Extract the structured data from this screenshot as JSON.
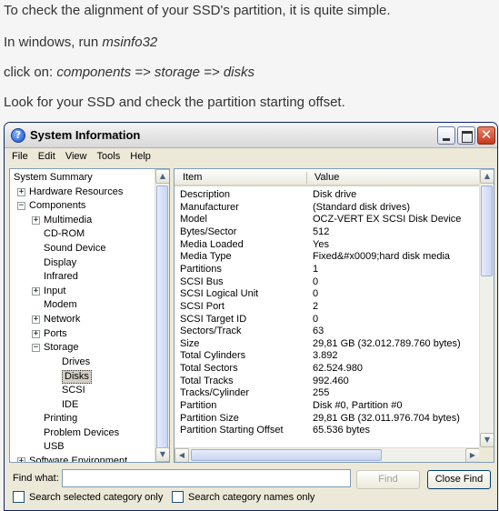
{
  "article": {
    "p1": "To check the alignment of your SSD's partition, it is quite simple.",
    "p2_prefix": "In windows, run ",
    "p2_cmd": "msinfo32",
    "p3_prefix": "click on: ",
    "p3_path": "components => storage => disks",
    "p4": "Look for your SSD and check the partition starting offset."
  },
  "window": {
    "title": "System Information",
    "app_icon": "help-icon",
    "close_glyph": "✕"
  },
  "menu": [
    "File",
    "Edit",
    "View",
    "Tools",
    "Help"
  ],
  "tree": [
    {
      "label": "System Summary",
      "expander": ""
    },
    {
      "label": "Hardware Resources",
      "expander": "+"
    },
    {
      "label": "Components",
      "expander": "−"
    },
    {
      "label": "Multimedia",
      "expander": "+"
    },
    {
      "label": "CD-ROM",
      "expander": ""
    },
    {
      "label": "Sound Device",
      "expander": ""
    },
    {
      "label": "Display",
      "expander": ""
    },
    {
      "label": "Infrared",
      "expander": ""
    },
    {
      "label": "Input",
      "expander": "+"
    },
    {
      "label": "Modem",
      "expander": ""
    },
    {
      "label": "Network",
      "expander": "+"
    },
    {
      "label": "Ports",
      "expander": "+"
    },
    {
      "label": "Storage",
      "expander": "−"
    },
    {
      "label": "Drives",
      "expander": ""
    },
    {
      "label": "Disks",
      "expander": "",
      "selected": true
    },
    {
      "label": "SCSI",
      "expander": ""
    },
    {
      "label": "IDE",
      "expander": ""
    },
    {
      "label": "Printing",
      "expander": ""
    },
    {
      "label": "Problem Devices",
      "expander": ""
    },
    {
      "label": "USB",
      "expander": ""
    },
    {
      "label": "Software Environment",
      "expander": "+"
    }
  ],
  "list": {
    "headers": {
      "item": "Item",
      "value": "Value"
    },
    "rows": [
      [
        "Description",
        "Disk drive"
      ],
      [
        "Manufacturer",
        "(Standard disk drives)"
      ],
      [
        "Model",
        "OCZ-VERT EX SCSI Disk Device"
      ],
      [
        "Bytes/Sector",
        "512"
      ],
      [
        "Media Loaded",
        "Yes"
      ],
      [
        "Media Type",
        "Fixed&#x0009;hard disk media"
      ],
      [
        "Partitions",
        "1"
      ],
      [
        "SCSI Bus",
        "0"
      ],
      [
        "SCSI Logical Unit",
        "0"
      ],
      [
        "SCSI Port",
        "2"
      ],
      [
        "SCSI Target ID",
        "0"
      ],
      [
        "Sectors/Track",
        "63"
      ],
      [
        "Size",
        "29,81 GB (32.012.789.760 bytes)"
      ],
      [
        "Total Cylinders",
        "3.892"
      ],
      [
        "Total Sectors",
        "62.524.980"
      ],
      [
        "Total Tracks",
        "992.460"
      ],
      [
        "Tracks/Cylinder",
        "255"
      ],
      [
        "Partition",
        "Disk #0, Partition #0"
      ],
      [
        "Partition Size",
        "29,81 GB (32.011.976.704 bytes)"
      ],
      [
        "Partition Starting Offset",
        "65.536 bytes"
      ]
    ]
  },
  "findbar": {
    "label": "Find what:",
    "value": "",
    "find_button": "Find",
    "close_button": "Close Find",
    "check1": "Search selected category only",
    "check2": "Search category names only"
  }
}
